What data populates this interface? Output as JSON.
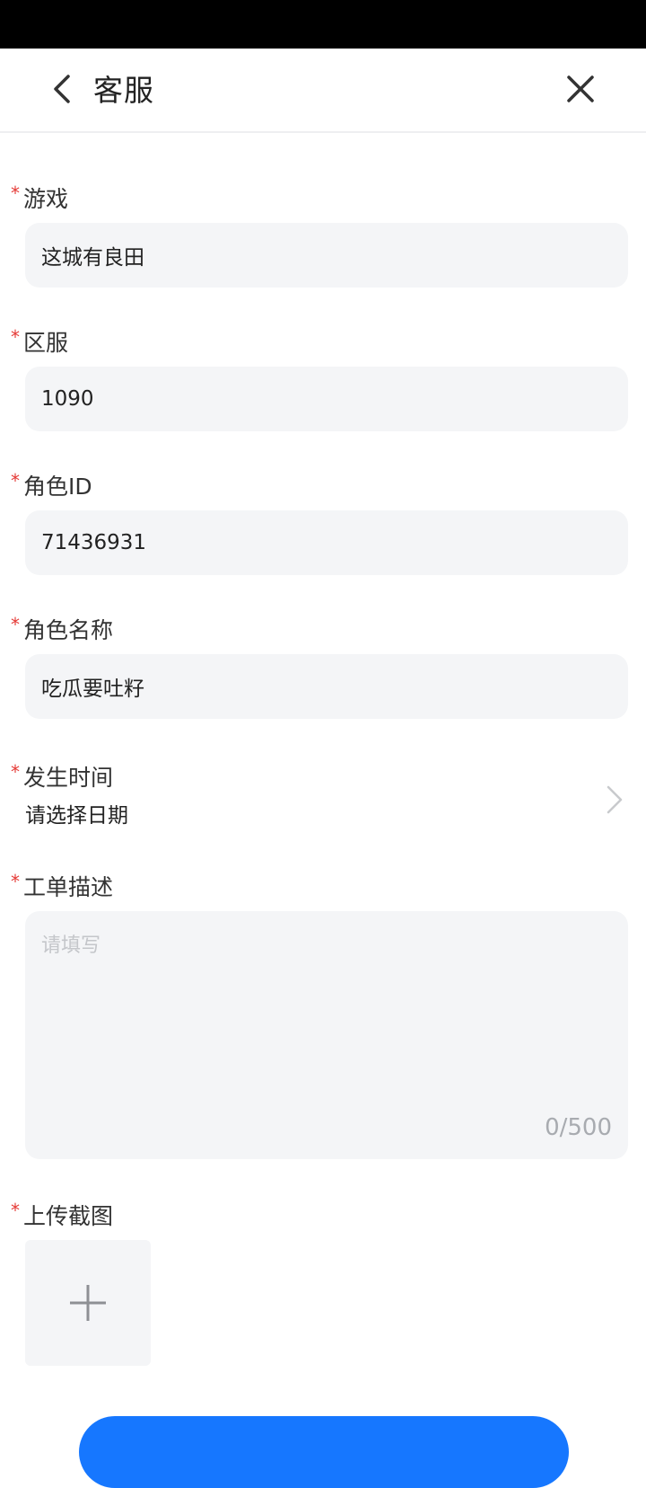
{
  "header": {
    "title": "客服"
  },
  "form": {
    "required_mark": "*",
    "game": {
      "label": "游戏",
      "value": "这城有良田"
    },
    "server": {
      "label": "区服",
      "value": "1090"
    },
    "role_id": {
      "label": "角色ID",
      "value": "71436931"
    },
    "role_name": {
      "label": "角色名称",
      "value": "吃瓜要吐籽"
    },
    "occur_time": {
      "label": "发生时间",
      "value": "请选择日期"
    },
    "description": {
      "label": "工单描述",
      "placeholder": "请填写",
      "char_count": "0/500"
    },
    "screenshot": {
      "label": "上传截图"
    }
  },
  "icons": {
    "back": "chevron-left-icon",
    "close": "close-icon",
    "date_arrow": "chevron-right-icon",
    "upload": "plus-icon"
  },
  "colors": {
    "required": "#e53935",
    "field_bg": "#f4f5f7",
    "primary": "#1677ff"
  }
}
